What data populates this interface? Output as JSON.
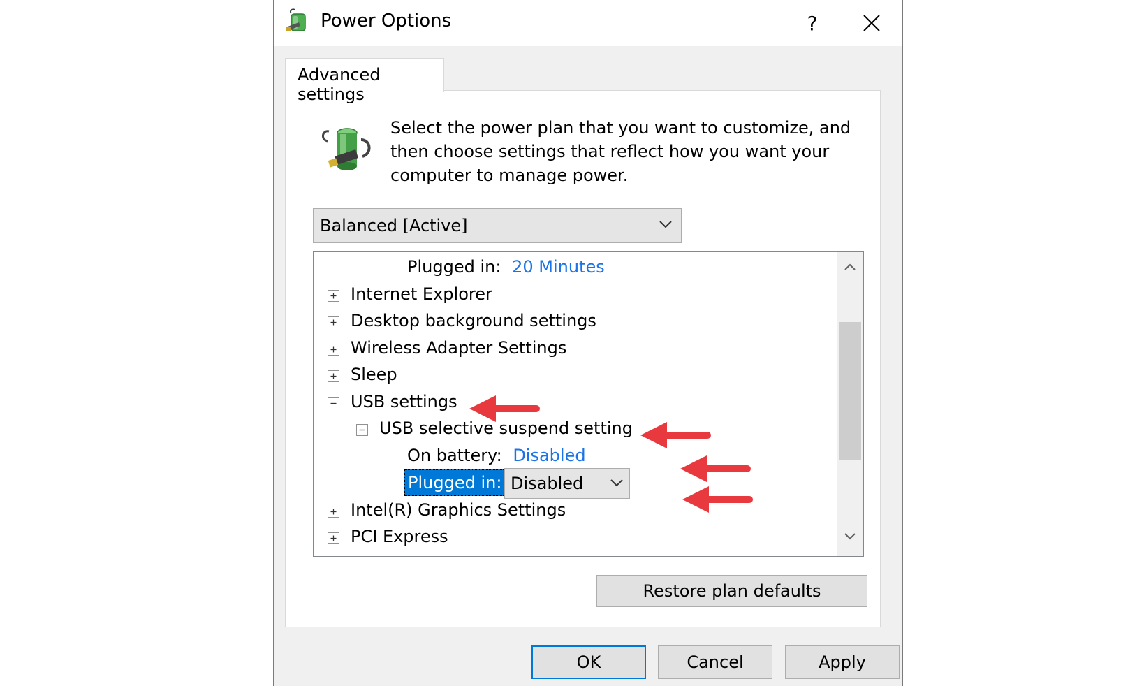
{
  "window": {
    "title": "Power Options",
    "help_label": "?",
    "close_icon": "close-icon"
  },
  "tabs": [
    {
      "label": "Advanced settings",
      "active": true
    }
  ],
  "description": "Select the power plan that you want to customize, and then choose settings that reflect how you want your computer to manage power.",
  "plan_select": {
    "value": "Balanced [Active]"
  },
  "tree": {
    "rows": [
      {
        "label": "Plugged in:",
        "value": "20 Minutes"
      },
      {
        "label": "Internet Explorer"
      },
      {
        "label": "Desktop background settings"
      },
      {
        "label": "Wireless Adapter Settings"
      },
      {
        "label": "Sleep"
      },
      {
        "label": "USB settings"
      },
      {
        "label": "USB selective suspend setting"
      },
      {
        "label": "On battery:",
        "value": "Disabled"
      },
      {
        "label": "Plugged in:",
        "value": "Disabled"
      },
      {
        "label": "Intel(R) Graphics Settings"
      },
      {
        "label": "PCI Express"
      }
    ]
  },
  "buttons": {
    "restore": "Restore plan defaults",
    "ok": "OK",
    "cancel": "Cancel",
    "apply": "Apply"
  },
  "colors": {
    "accent": "#0078d7",
    "link_value": "#1a73e8",
    "annotation_arrow": "#e8393f"
  }
}
